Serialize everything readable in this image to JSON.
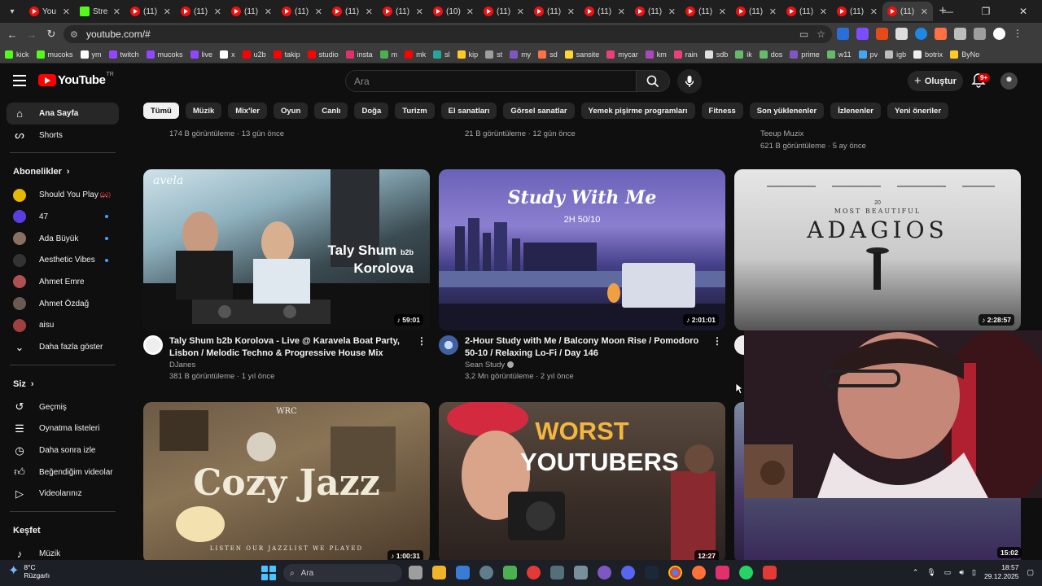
{
  "browser": {
    "tabs": [
      {
        "title": "You",
        "icon": "youtube-icon"
      },
      {
        "title": "Stre",
        "icon": "kick-icon"
      },
      {
        "title": "(11)",
        "icon": "youtube-icon"
      },
      {
        "title": "(11)",
        "icon": "youtube-icon"
      },
      {
        "title": "(11)",
        "icon": "youtube-icon"
      },
      {
        "title": "(11)",
        "icon": "youtube-icon"
      },
      {
        "title": "(11)",
        "icon": "youtube-icon"
      },
      {
        "title": "(11)",
        "icon": "youtube-icon"
      },
      {
        "title": "(10)",
        "icon": "youtube-icon"
      },
      {
        "title": "(11)",
        "icon": "youtube-icon"
      },
      {
        "title": "(11)",
        "icon": "youtube-icon"
      },
      {
        "title": "(11)",
        "icon": "youtube-icon"
      },
      {
        "title": "(11)",
        "icon": "youtube-icon"
      },
      {
        "title": "(11)",
        "icon": "youtube-icon"
      },
      {
        "title": "(11)",
        "icon": "youtube-icon"
      },
      {
        "title": "(11)",
        "icon": "youtube-icon"
      },
      {
        "title": "(11)",
        "icon": "youtube-icon"
      },
      {
        "title": "(11)",
        "icon": "youtube-icon",
        "active": true
      }
    ],
    "url": "youtube.com/#",
    "bookmarks": [
      {
        "label": "kick",
        "color": "#53fc18"
      },
      {
        "label": "mucoks",
        "color": "#53fc18"
      },
      {
        "label": "ym",
        "color": "#ffffff"
      },
      {
        "label": "twitch",
        "color": "#9146ff"
      },
      {
        "label": "mucoks",
        "color": "#9146ff"
      },
      {
        "label": "live",
        "color": "#9146ff"
      },
      {
        "label": "x",
        "color": "#ffffff"
      },
      {
        "label": "u2b",
        "color": "#ff0000"
      },
      {
        "label": "takip",
        "color": "#ff0000"
      },
      {
        "label": "studio",
        "color": "#ff0000"
      },
      {
        "label": "insta",
        "color": "#e1306c"
      },
      {
        "label": "m",
        "color": "#4caf50"
      },
      {
        "label": "mk",
        "color": "#ff0000"
      },
      {
        "label": "sl",
        "color": "#26a69a"
      },
      {
        "label": "kip",
        "color": "#ffca28"
      },
      {
        "label": "st",
        "color": "#9e9e9e"
      },
      {
        "label": "my",
        "color": "#7e57c2"
      },
      {
        "label": "sd",
        "color": "#ff7043"
      },
      {
        "label": "sansite",
        "color": "#fdd835"
      },
      {
        "label": "mycar",
        "color": "#ec407a"
      },
      {
        "label": "km",
        "color": "#ab47bc"
      },
      {
        "label": "rain",
        "color": "#ec407a"
      },
      {
        "label": "sdb",
        "color": "#e0e0e0"
      },
      {
        "label": "ik",
        "color": "#66bb6a"
      },
      {
        "label": "dos",
        "color": "#66bb6a"
      },
      {
        "label": "prime",
        "color": "#7e57c2"
      },
      {
        "label": "w11",
        "color": "#66bb6a"
      },
      {
        "label": "pv",
        "color": "#42a5f5"
      },
      {
        "label": "igb",
        "color": "#bdbdbd"
      },
      {
        "label": "botrix",
        "color": "#eeeeee"
      },
      {
        "label": "ByNo",
        "color": "#ffca28"
      }
    ]
  },
  "header": {
    "logo_text": "YouTube",
    "logo_country": "TR",
    "search_placeholder": "Ara",
    "create_label": "Oluştur",
    "notif_badge": "9+"
  },
  "sidebar": {
    "home": "Ana Sayfa",
    "shorts": "Shorts",
    "subs_title": "Abonelikler",
    "subscriptions": [
      {
        "name": "Should You Play ...",
        "color": "#e6b800",
        "indicator": "live"
      },
      {
        "name": "47",
        "color": "#5b3ee0",
        "indicator": "dot"
      },
      {
        "name": "Ada Büyük",
        "color": "#8a7060",
        "indicator": "dot"
      },
      {
        "name": "Aesthetic Vibes",
        "color": "#333333",
        "indicator": "dot"
      },
      {
        "name": "Ahmet Emre",
        "color": "#b05050",
        "indicator": ""
      },
      {
        "name": "Ahmet Özdağ",
        "color": "#6a5a50",
        "indicator": ""
      },
      {
        "name": "aisu",
        "color": "#a04040",
        "indicator": ""
      }
    ],
    "show_more": "Daha fazla göster",
    "you_title": "Siz",
    "you_items": [
      "Geçmiş",
      "Oynatma listeleri",
      "Daha sonra izle",
      "Beğendiğim videolar",
      "Videolarınız"
    ],
    "explore_title": "Keşfet",
    "explore_items": [
      "Müzik"
    ]
  },
  "chips": [
    "Tümü",
    "Müzik",
    "Mix'ler",
    "Oyun",
    "Canlı",
    "Doğa",
    "Turizm",
    "El sanatları",
    "Görsel sanatlar",
    "Yemek pişirme programları",
    "Fitness",
    "Son yüklenenler",
    "İzlenenler",
    "Yeni öneriler"
  ],
  "prev_row": [
    {
      "meta": "174 B görüntüleme · 13 gün önce"
    },
    {
      "meta": "21 B görüntüleme · 12 gün önce"
    },
    {
      "channel": "Teeup Muzix",
      "meta": "621 B görüntüleme · 5 ay önce"
    }
  ],
  "videos": [
    {
      "title": "Taly Shum b2b Korolova - Live @ Karavela Boat Party, Lisbon / Melodic Techno & Progressive House Mix",
      "channel": "DJanes",
      "meta": "381 B görüntüleme · 1 yıl önce",
      "duration": "59:01",
      "thumb_line1": "Taly Shum",
      "thumb_small": "b2b",
      "thumb_line2": "Korolova",
      "thumb_corner": "avela"
    },
    {
      "title": "2-Hour Study with Me / Balcony Moon Rise / Pomodoro 50-10 / Relaxing Lo-Fi / Day 146",
      "channel": "Sean Study",
      "meta": "3,2 Mn görüntüleme · 2 yıl önce",
      "duration": "2:01:01",
      "thumb_line1": "Study With Me",
      "thumb_line2": "2H 50/10"
    },
    {
      "duration": "2:28:57",
      "thumb_top": "20",
      "thumb_line1": "MOST BEAUTIFUL",
      "thumb_line2": "ADAGIOS"
    },
    {
      "duration": "1:00:31",
      "thumb_top": "WRC",
      "thumb_line1": "Cozy Jazz",
      "thumb_line2": "LISTEN OUR JAZZLIST WE PLAYED"
    },
    {
      "duration": "12:27",
      "thumb_line1": "WORST",
      "thumb_line2": "YOUTUBERS"
    },
    {
      "duration": "15:02"
    }
  ],
  "taskbar": {
    "temp": "8°C",
    "weather": "Rüzgarlı",
    "search": "Ara",
    "time": "18:57",
    "date": "29.12.2025"
  }
}
